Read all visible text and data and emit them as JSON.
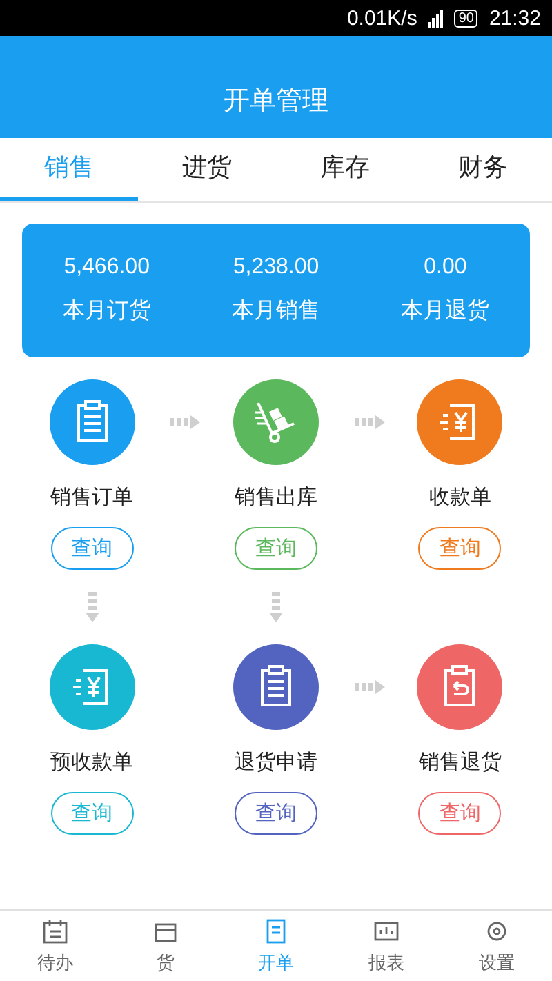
{
  "status_bar": {
    "speed": "0.01K/s",
    "battery": "90",
    "time": "21:32"
  },
  "header": {
    "title": "开单管理"
  },
  "tabs": [
    {
      "label": "销售",
      "selected": true
    },
    {
      "label": "进货",
      "selected": false
    },
    {
      "label": "库存",
      "selected": false
    },
    {
      "label": "财务",
      "selected": false
    }
  ],
  "summary": [
    {
      "value": "5,466.00",
      "label": "本月订货"
    },
    {
      "value": "5,238.00",
      "label": "本月销售"
    },
    {
      "value": "0.00",
      "label": "本月退货"
    }
  ],
  "flows": [
    {
      "label": "销售订单",
      "kind": "clipboard",
      "color": "#1a9ff0",
      "button": "查询",
      "arrow_right": true,
      "arrow_down": true
    },
    {
      "label": "销售出库",
      "kind": "cart",
      "color": "#5cb85c",
      "button": "查询",
      "arrow_right": true,
      "arrow_down": true
    },
    {
      "label": "收款单",
      "kind": "yen",
      "color": "#f07a1e",
      "button": "查询",
      "arrow_right": false,
      "arrow_down": false
    },
    {
      "label": "预收款单",
      "kind": "yen",
      "color": "#19b8d2",
      "button": "查询",
      "arrow_right": false,
      "arrow_down": false
    },
    {
      "label": "退货申请",
      "kind": "clipboard",
      "color": "#5264c0",
      "button": "查询",
      "arrow_right": true,
      "arrow_down": false
    },
    {
      "label": "销售退货",
      "kind": "return",
      "color": "#ee6666",
      "button": "查询",
      "arrow_right": false,
      "arrow_down": false
    }
  ],
  "bottom_nav": [
    {
      "label": "待办",
      "kind": "calendar",
      "selected": false
    },
    {
      "label": "货",
      "kind": "box",
      "selected": false
    },
    {
      "label": "开单",
      "kind": "doc",
      "selected": true
    },
    {
      "label": "报表",
      "kind": "chart",
      "selected": false
    },
    {
      "label": "设置",
      "kind": "gear",
      "selected": false
    }
  ]
}
